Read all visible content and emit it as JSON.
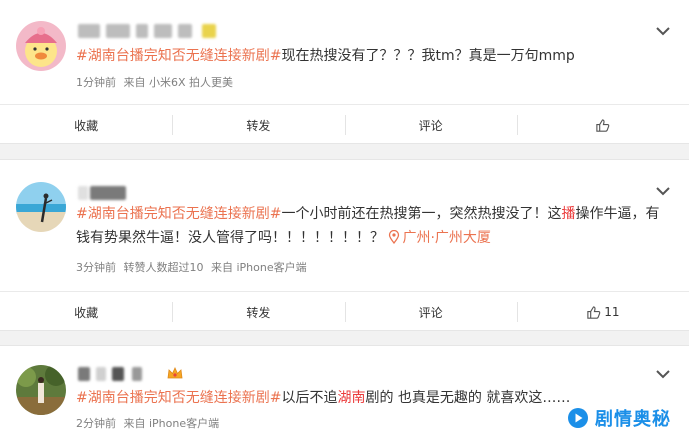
{
  "posts": [
    {
      "hashtag": "#湖南台播完知否无缝连接新剧#",
      "text_parts": [
        "现在热搜没有了？？？我tm？真是一万句mmp"
      ],
      "meta": {
        "time": "1分钟前",
        "source": "来自 小米6X 拍人更美"
      },
      "actions": {
        "repost": "转发",
        "comment": "评论",
        "favorite": "收藏",
        "like_count": ""
      }
    },
    {
      "hashtag": "#湖南台播完知否无缝连接新剧#",
      "text_before": "一个小时前还在热搜第一，突然热搜没了！这",
      "text_highlight": "播",
      "text_after": "操作牛逼，有钱有势果然牛逼！没人管得了吗！！！！！！！？",
      "location": "广州·广州大厦",
      "meta": {
        "time": "3分钟前",
        "extra": "转赞人数超过10",
        "source": "来自 iPhone客户端"
      },
      "actions": {
        "repost": "转发",
        "comment": "评论",
        "favorite": "收藏",
        "like_count": "11"
      }
    },
    {
      "hashtag": "#湖南台播完知否无缝连接新剧#",
      "text_before": "以后不追",
      "text_highlight": "湖南",
      "text_after": "剧的 也真是无趣的 就喜欢这……",
      "meta": {
        "time": "2分钟前",
        "source": "来自 iPhone客户端"
      }
    }
  ],
  "watermark": {
    "text": "剧情奥秘"
  },
  "colors": {
    "tag": "#eb7350",
    "highlight": "#eb3b3b",
    "meta": "#808080",
    "watermark": "#1b8fe8"
  },
  "icons": [
    "chevron-down-icon",
    "like-icon",
    "location-pin-icon",
    "crown-icon"
  ]
}
